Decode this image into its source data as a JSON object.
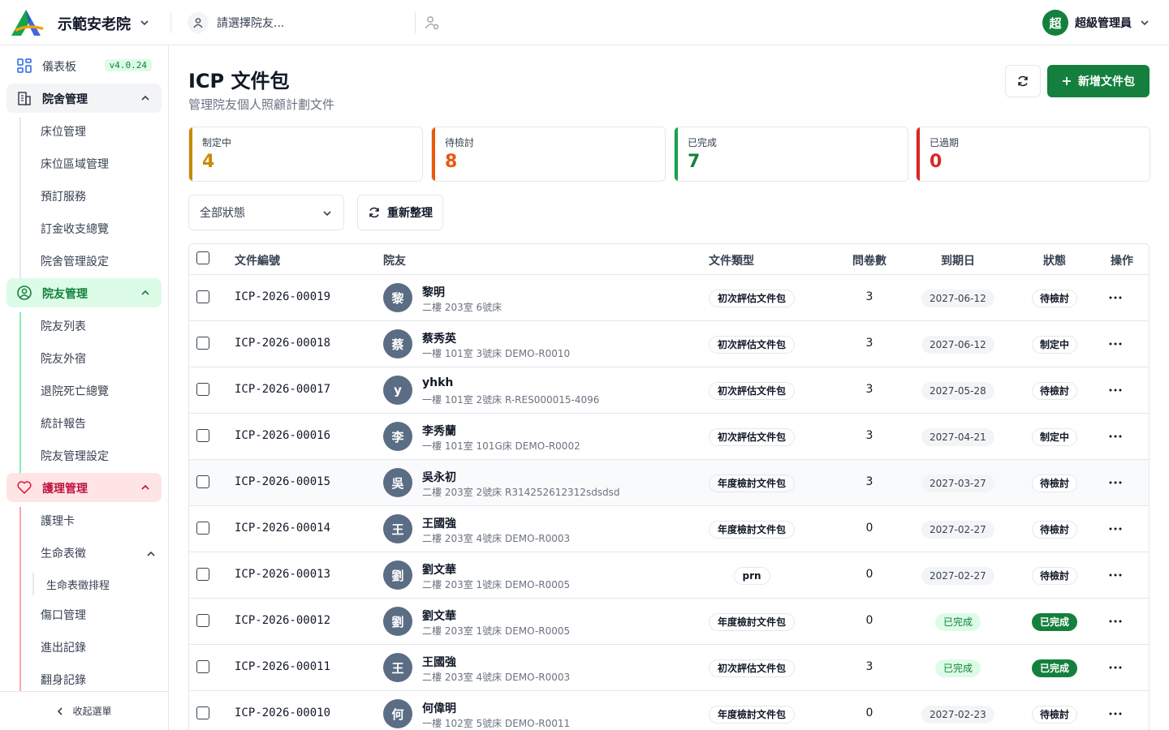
{
  "header": {
    "org_name": "示範安老院",
    "resident_placeholder": "請選擇院友...",
    "user_initial": "超",
    "user_name": "超級管理員"
  },
  "sidebar": {
    "dashboard": "儀表板",
    "version": "v4.0.24",
    "groups": [
      {
        "label": "院舍管理",
        "items": [
          "床位管理",
          "床位區域管理",
          "預訂服務",
          "訂金收支總覽",
          "院舍管理設定"
        ]
      },
      {
        "label": "院友管理",
        "items": [
          "院友列表",
          "院友外宿",
          "退院死亡總覽",
          "統計報告",
          "院友管理設定"
        ]
      },
      {
        "label": "護理管理",
        "items": [
          "護理卡",
          "生命表徵",
          "生命表徵排程",
          "傷口管理",
          "進出記錄",
          "翻身記錄"
        ]
      }
    ],
    "collapse_label": "收起選單"
  },
  "page": {
    "title": "ICP 文件包",
    "subtitle": "管理院友個人照顧計劃文件",
    "new_button": "新增文件包",
    "filter_status": "全部狀態",
    "reload_button": "重新整理"
  },
  "stats": [
    {
      "label": "制定中",
      "value": "4",
      "color": "#ca8a04"
    },
    {
      "label": "待檢討",
      "value": "8",
      "color": "#ea580c"
    },
    {
      "label": "已完成",
      "value": "7",
      "color": "#16a34a"
    },
    {
      "label": "已過期",
      "value": "0",
      "color": "#dc2626"
    }
  ],
  "table": {
    "columns": [
      "文件編號",
      "院友",
      "文件類型",
      "問卷數",
      "到期日",
      "狀態",
      "操作"
    ],
    "rows": [
      {
        "doc_no": "ICP-2026-00019",
        "initial": "黎",
        "name": "黎明",
        "detail": "二樓 203室 6號床",
        "type": "初次評估文件包",
        "q": "3",
        "due": "2027-06-12",
        "due_done": false,
        "status": "待檢討",
        "status_done": false
      },
      {
        "doc_no": "ICP-2026-00018",
        "initial": "蔡",
        "name": "蔡秀英",
        "detail": "一樓 101室 3號床 DEMO-R0010",
        "type": "初次評估文件包",
        "q": "3",
        "due": "2027-06-12",
        "due_done": false,
        "status": "制定中",
        "status_done": false
      },
      {
        "doc_no": "ICP-2026-00017",
        "initial": "y",
        "name": "yhkh",
        "detail": "一樓 101室 2號床 R-RES000015-4096",
        "type": "初次評估文件包",
        "q": "3",
        "due": "2027-05-28",
        "due_done": false,
        "status": "待檢討",
        "status_done": false
      },
      {
        "doc_no": "ICP-2026-00016",
        "initial": "李",
        "name": "李秀蘭",
        "detail": "一樓 101室 101G床 DEMO-R0002",
        "type": "初次評估文件包",
        "q": "3",
        "due": "2027-04-21",
        "due_done": false,
        "status": "制定中",
        "status_done": false
      },
      {
        "doc_no": "ICP-2026-00015",
        "initial": "吳",
        "name": "吳永初",
        "detail": "二樓 203室 2號床 R314252612312sdsdsd",
        "type": "年度檢討文件包",
        "q": "3",
        "due": "2027-03-27",
        "due_done": false,
        "status": "待檢討",
        "status_done": false
      },
      {
        "doc_no": "ICP-2026-00014",
        "initial": "王",
        "name": "王國強",
        "detail": "二樓 203室 4號床 DEMO-R0003",
        "type": "年度檢討文件包",
        "q": "0",
        "due": "2027-02-27",
        "due_done": false,
        "status": "待檢討",
        "status_done": false
      },
      {
        "doc_no": "ICP-2026-00013",
        "initial": "劉",
        "name": "劉文華",
        "detail": "二樓 203室 1號床 DEMO-R0005",
        "type": "prn",
        "q": "0",
        "due": "2027-02-27",
        "due_done": false,
        "status": "待檢討",
        "status_done": false
      },
      {
        "doc_no": "ICP-2026-00012",
        "initial": "劉",
        "name": "劉文華",
        "detail": "二樓 203室 1號床 DEMO-R0005",
        "type": "年度檢討文件包",
        "q": "0",
        "due": "已完成",
        "due_done": true,
        "status": "已完成",
        "status_done": true
      },
      {
        "doc_no": "ICP-2026-00011",
        "initial": "王",
        "name": "王國強",
        "detail": "二樓 203室 4號床 DEMO-R0003",
        "type": "初次評估文件包",
        "q": "3",
        "due": "已完成",
        "due_done": true,
        "status": "已完成",
        "status_done": true
      },
      {
        "doc_no": "ICP-2026-00010",
        "initial": "何",
        "name": "何偉明",
        "detail": "一樓 102室 5號床 DEMO-R0011",
        "type": "年度檢討文件包",
        "q": "0",
        "due": "2027-02-23",
        "due_done": false,
        "status": "待檢討",
        "status_done": false
      }
    ]
  }
}
